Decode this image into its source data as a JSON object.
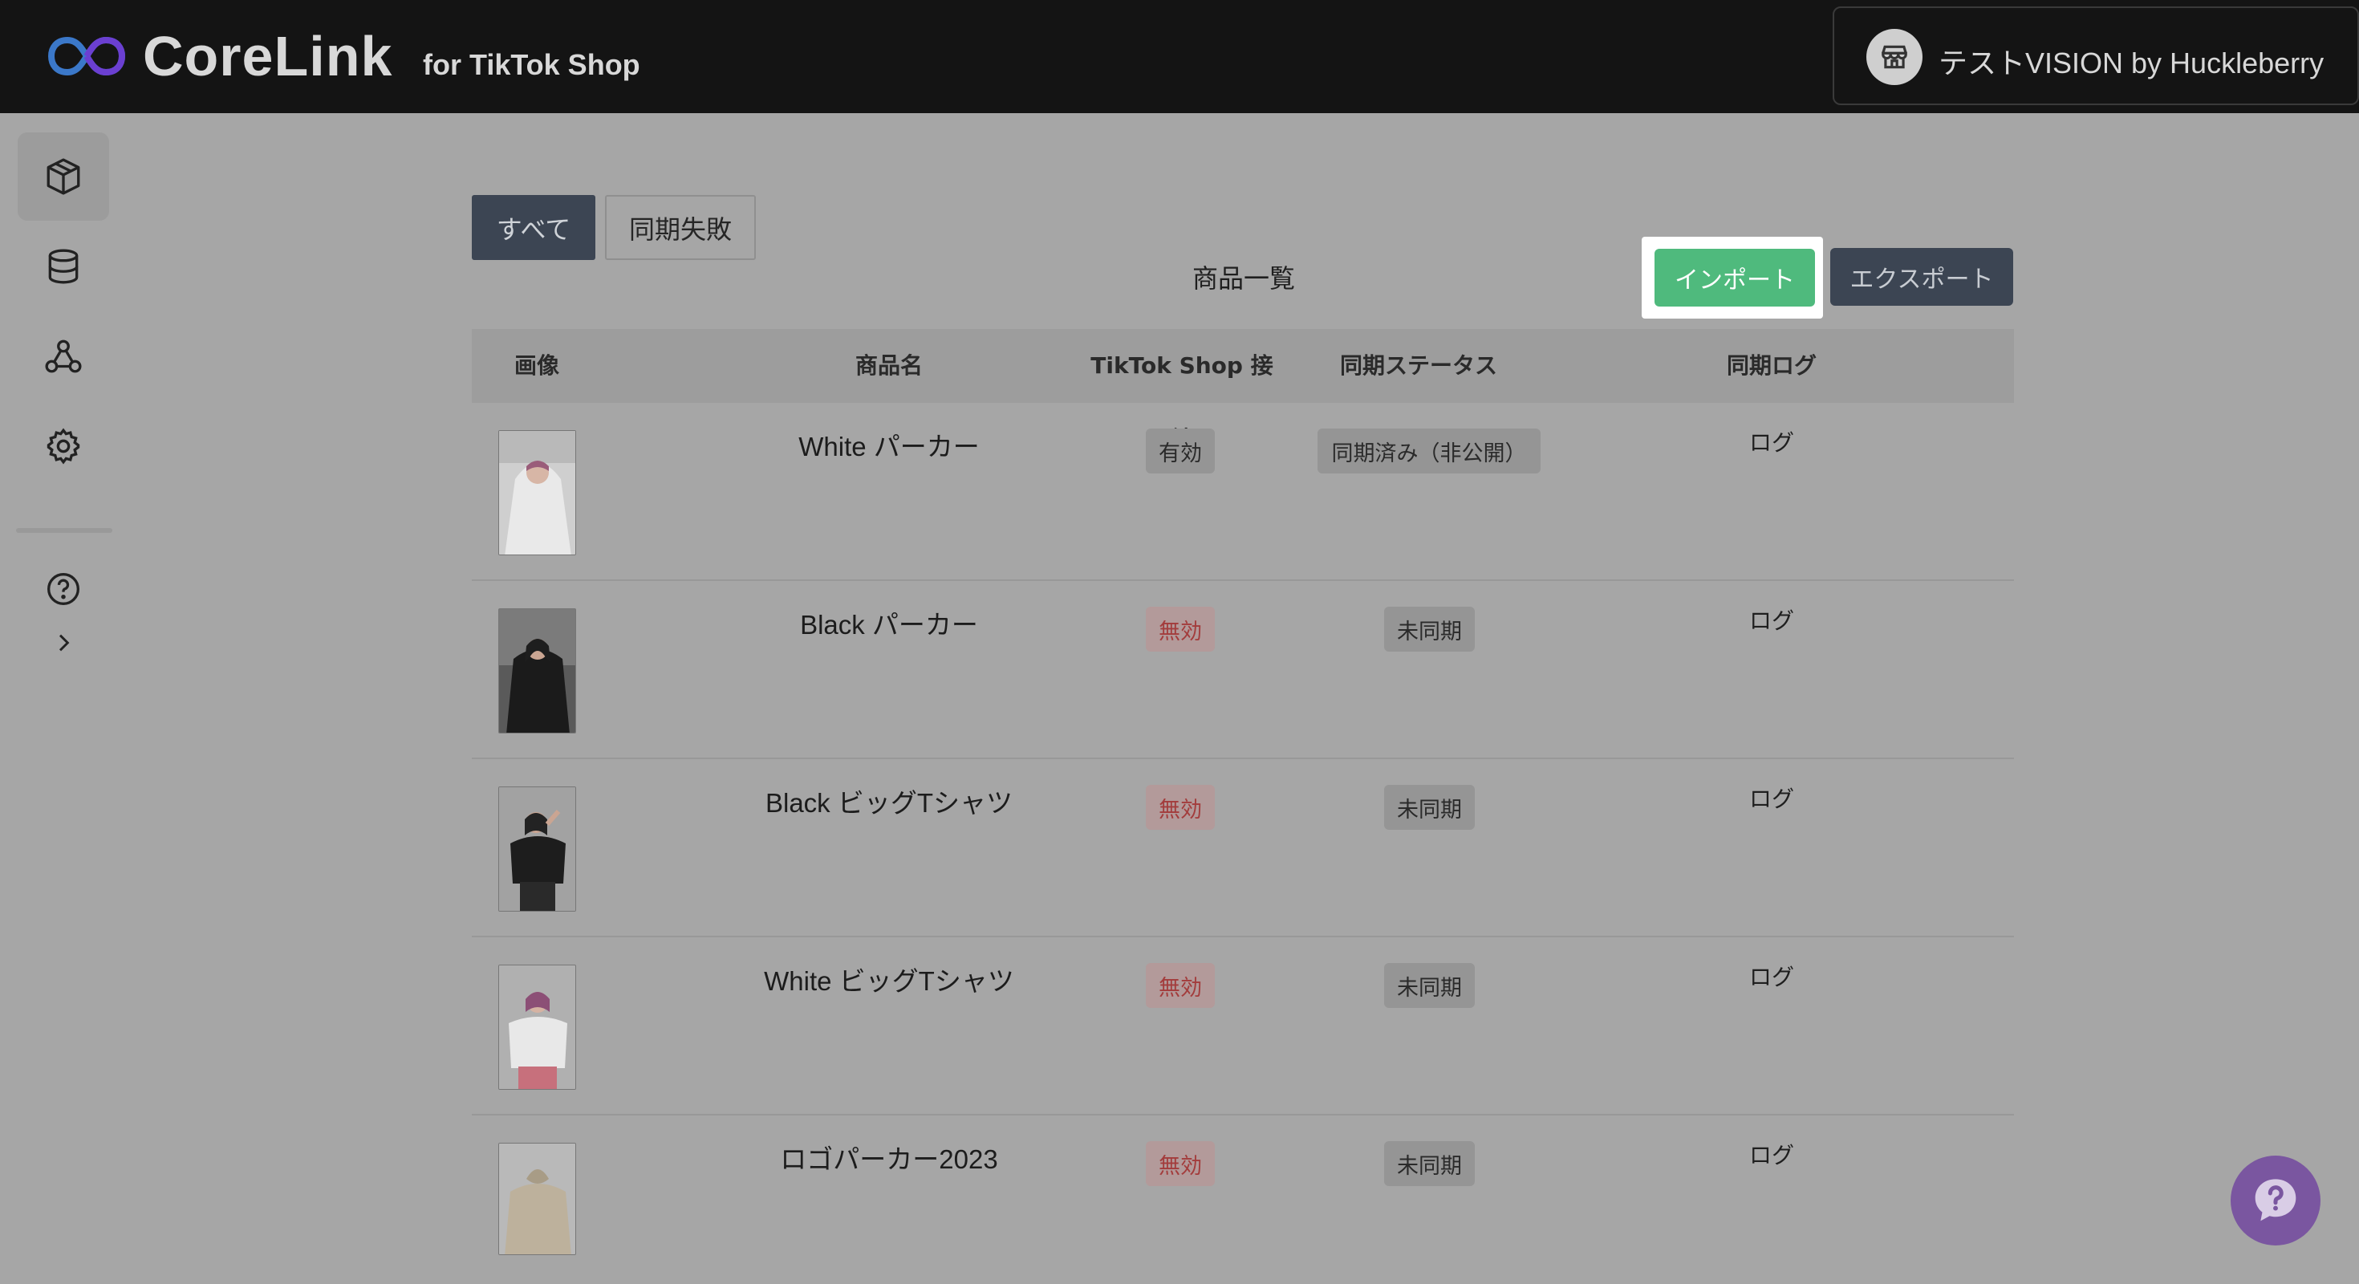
{
  "brand": {
    "name": "CoreLink",
    "sub": "for TikTok Shop",
    "logo_colors": [
      "#2e8fd6",
      "#6b3fd1"
    ]
  },
  "store": {
    "name": "テストVISION by Huckleberry",
    "icon": "store-icon"
  },
  "sidebar": {
    "items": [
      {
        "icon": "box-icon",
        "active": true
      },
      {
        "icon": "database-icon",
        "active": false
      },
      {
        "icon": "webhook-icon",
        "active": false
      },
      {
        "icon": "gear-icon",
        "active": false
      },
      {
        "icon": "help-circle-icon",
        "active": false
      },
      {
        "icon": "chevron-right-icon",
        "active": false
      }
    ]
  },
  "tabs": {
    "all": "すべて",
    "failed": "同期失敗"
  },
  "list_title": "商品一覧",
  "actions": {
    "import": "インポート",
    "export": "エクスポート"
  },
  "table": {
    "headers": {
      "image": "画像",
      "name": "商品名",
      "connection": "TikTok Shop 接続",
      "status": "同期ステータス",
      "log": "同期ログ"
    },
    "rows": [
      {
        "name": "White パーカー",
        "connection": "有効",
        "connection_state": "ok",
        "status": "同期済み（非公開）",
        "log": "ログ",
        "thumb": "white-hoodie"
      },
      {
        "name": "Black パーカー",
        "connection": "無効",
        "connection_state": "ng",
        "status": "未同期",
        "log": "ログ",
        "thumb": "black-hoodie"
      },
      {
        "name": "Black ビッグTシャツ",
        "connection": "無効",
        "connection_state": "ng",
        "status": "未同期",
        "log": "ログ",
        "thumb": "black-tshirt"
      },
      {
        "name": "White ビッグTシャツ",
        "connection": "無効",
        "connection_state": "ng",
        "status": "未同期",
        "log": "ログ",
        "thumb": "white-tshirt"
      },
      {
        "name": "ロゴパーカー2023",
        "connection": "無効",
        "connection_state": "ng",
        "status": "未同期",
        "log": "ログ",
        "thumb": "logo-hoodie"
      }
    ]
  },
  "colors": {
    "import": "#4fba7d",
    "export": "#3c4553",
    "invalid_text": "#a33c3c",
    "help": "#7a56a0"
  }
}
